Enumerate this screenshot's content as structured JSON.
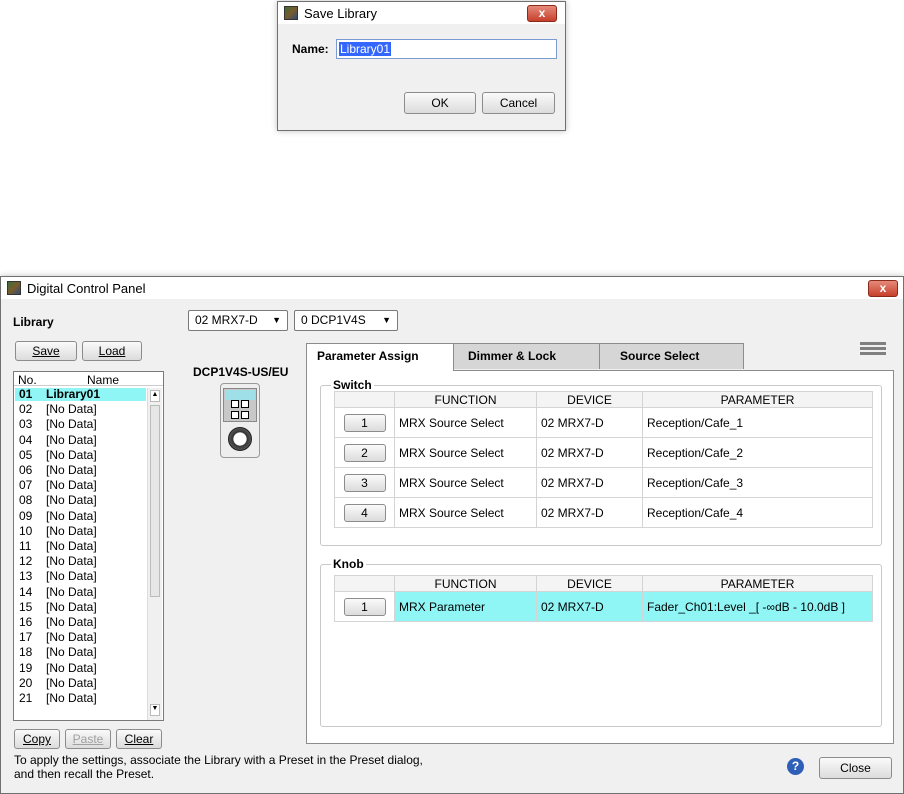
{
  "dialog": {
    "title": "Save Library",
    "close_symbol": "x",
    "name_label": "Name:",
    "name_value": "Library01",
    "ok_label": "OK",
    "cancel_label": "Cancel"
  },
  "window": {
    "title": "Digital Control Panel",
    "close_symbol": "x",
    "library_label": "Library",
    "save_label": "Save",
    "load_label": "Load",
    "device_select": "02 MRX7-D",
    "panel_select": "0 DCP1V4S",
    "model_label": "DCP1V4S-US/EU",
    "list_header": {
      "no": "No.",
      "name": "Name"
    },
    "list_rows": [
      {
        "no": "01",
        "name": "Library01"
      },
      {
        "no": "02",
        "name": "[No Data]"
      },
      {
        "no": "03",
        "name": "[No Data]"
      },
      {
        "no": "04",
        "name": "[No Data]"
      },
      {
        "no": "05",
        "name": "[No Data]"
      },
      {
        "no": "06",
        "name": "[No Data]"
      },
      {
        "no": "07",
        "name": "[No Data]"
      },
      {
        "no": "08",
        "name": "[No Data]"
      },
      {
        "no": "09",
        "name": "[No Data]"
      },
      {
        "no": "10",
        "name": "[No Data]"
      },
      {
        "no": "11",
        "name": "[No Data]"
      },
      {
        "no": "12",
        "name": "[No Data]"
      },
      {
        "no": "13",
        "name": "[No Data]"
      },
      {
        "no": "14",
        "name": "[No Data]"
      },
      {
        "no": "15",
        "name": "[No Data]"
      },
      {
        "no": "16",
        "name": "[No Data]"
      },
      {
        "no": "17",
        "name": "[No Data]"
      },
      {
        "no": "18",
        "name": "[No Data]"
      },
      {
        "no": "19",
        "name": "[No Data]"
      },
      {
        "no": "20",
        "name": "[No Data]"
      },
      {
        "no": "21",
        "name": "[No Data]"
      }
    ],
    "copy_label": "Copy",
    "paste_label": "Paste",
    "clear_label": "Clear",
    "hint_line1": "To apply the settings, associate the Library with a Preset in the Preset dialog,",
    "hint_line2": "and then recall the Preset.",
    "close_label": "Close",
    "tabs": [
      "Parameter Assign",
      "Dimmer & Lock",
      "Source Select"
    ],
    "switch_title": "Switch",
    "knob_title": "Knob",
    "col_function": "FUNCTION",
    "col_device": "DEVICE",
    "col_parameter": "PARAMETER",
    "switch_rows": [
      {
        "btn": "1",
        "function": "MRX Source Select",
        "device": "02 MRX7-D",
        "parameter": "Reception/Cafe_1"
      },
      {
        "btn": "2",
        "function": "MRX Source Select",
        "device": "02 MRX7-D",
        "parameter": "Reception/Cafe_2"
      },
      {
        "btn": "3",
        "function": "MRX Source Select",
        "device": "02 MRX7-D",
        "parameter": "Reception/Cafe_3"
      },
      {
        "btn": "4",
        "function": "MRX Source Select",
        "device": "02 MRX7-D",
        "parameter": "Reception/Cafe_4"
      }
    ],
    "knob_rows": [
      {
        "btn": "1",
        "function": "MRX Parameter",
        "device": "02 MRX7-D",
        "parameter": "Fader_Ch01:Level _[ -∞dB - 10.0dB ]"
      }
    ]
  },
  "colors": {
    "highlight": "#8ff5f5",
    "selection": "#3366ff",
    "close_red": "#c7402c"
  }
}
